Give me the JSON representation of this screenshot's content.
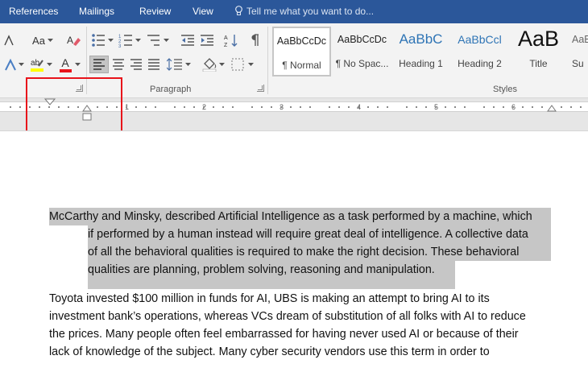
{
  "tabs": [
    "References",
    "Mailings",
    "Review",
    "View"
  ],
  "tell_me": "Tell me what you want to do...",
  "groups": {
    "paragraph": "Paragraph",
    "styles": "Styles"
  },
  "font_buttons": {
    "case": "Aa",
    "font_color": "A"
  },
  "styles": [
    {
      "preview": "AaBbCcDc",
      "name": "¶ Normal"
    },
    {
      "preview": "AaBbCcDc",
      "name": "¶ No Spac..."
    },
    {
      "preview": "AaBbC",
      "name": "Heading 1"
    },
    {
      "preview": "AaBbCcl",
      "name": "Heading 2"
    },
    {
      "preview": "AaB",
      "name": "Title"
    },
    {
      "preview": "AaBbC",
      "name": "Su"
    }
  ],
  "ruler_numbers": [
    "1",
    "2",
    "3",
    "4",
    "5",
    "6"
  ],
  "colors": {
    "tabbar": "#2b579a",
    "highlight": "#c6c6c6",
    "callout": "#e8141b"
  },
  "document": {
    "paragraph1": [
      "McCarthy and Minsky, described Artificial Intelligence as a task performed by a machine, which",
      "if performed by a human instead will require great deal of intelligence. A collective data",
      "of all the behavioral qualities is required to make the right decision. These behavioral",
      "qualities are planning, problem solving, reasoning and manipulation."
    ],
    "paragraph2": [
      "Toyota invested $100 million in funds for AI, UBS is making an attempt to bring AI to its",
      "investment bank’s operations, whereas VCs dream of substitution of all folks with AI to reduce",
      "the prices. Many people often feel embarrassed for having never used AI or because of their",
      "lack of knowledge of the subject. Many cyber security vendors use this term in order to"
    ]
  }
}
